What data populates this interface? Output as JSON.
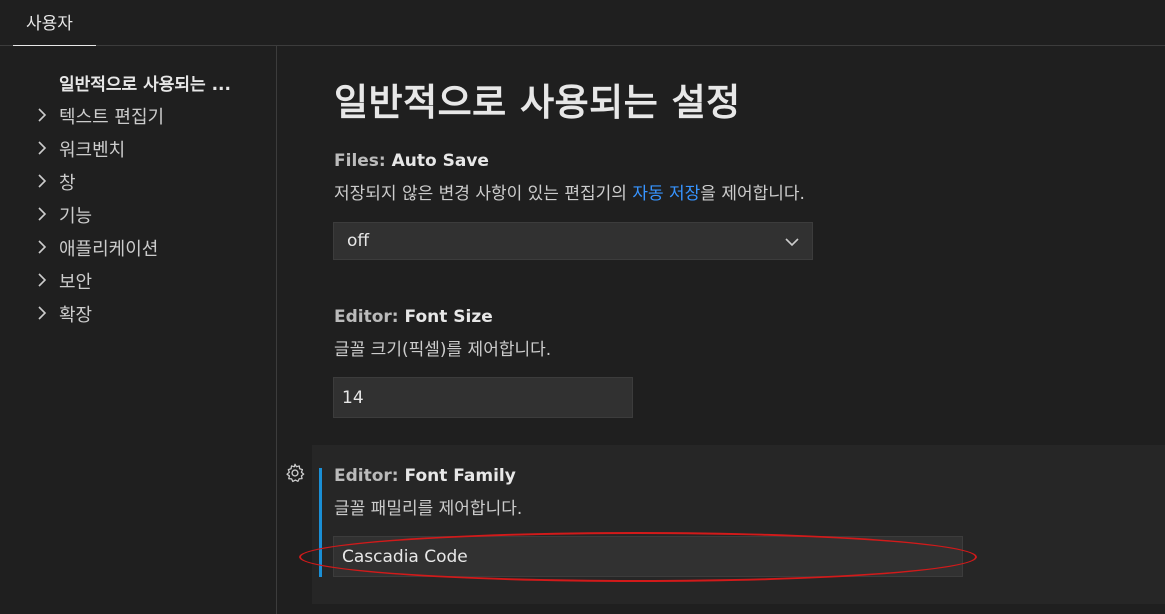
{
  "scope_tab": "사용자",
  "toc": {
    "items": [
      {
        "label": "일반적으로 사용되는 ...",
        "active": true,
        "expandable": false
      },
      {
        "label": "텍스트 편집기",
        "active": false,
        "expandable": true
      },
      {
        "label": "워크벤치",
        "active": false,
        "expandable": true
      },
      {
        "label": "창",
        "active": false,
        "expandable": true
      },
      {
        "label": "기능",
        "active": false,
        "expandable": true
      },
      {
        "label": "애플리케이션",
        "active": false,
        "expandable": true
      },
      {
        "label": "보안",
        "active": false,
        "expandable": true
      },
      {
        "label": "확장",
        "active": false,
        "expandable": true
      }
    ]
  },
  "main": {
    "title": "일반적으로 사용되는 설정",
    "settings": {
      "auto_save": {
        "category": "Files: ",
        "name": "Auto Save",
        "desc_before": "저장되지 않은 변경 사항이 있는 편집기의 ",
        "desc_link": "자동 저장",
        "desc_after": "을 제어합니다.",
        "value": "off"
      },
      "font_size": {
        "category": "Editor: ",
        "name": "Font Size",
        "desc": "글꼴 크기(픽셀)를 제어합니다.",
        "value": "14"
      },
      "font_family": {
        "category": "Editor: ",
        "name": "Font Family",
        "desc": "글꼴 패밀리를 제어합니다.",
        "value": "Cascadia Code"
      }
    }
  },
  "colors": {
    "background": "#1f1f1f",
    "link": "#3794ff",
    "focus_bar": "#1a8fd6",
    "annotation": "#d21a1a"
  },
  "icons": {
    "chevron_right": "chevron-right-icon",
    "chevron_down": "chevron-down-icon",
    "gear": "gear-icon"
  }
}
